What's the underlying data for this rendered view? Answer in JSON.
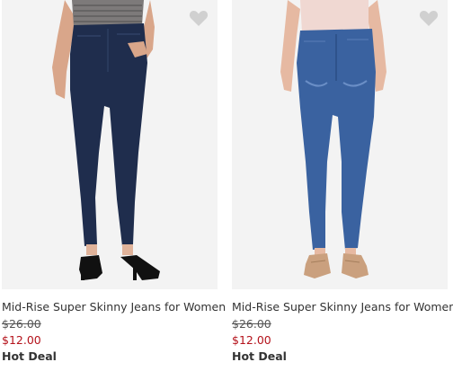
{
  "products": [
    {
      "title": "Mid-Rise Super Skinny Jeans for Women",
      "original_price": "$26.00",
      "sale_price": "$12.00",
      "badge": "Hot Deal",
      "wash_color": "#1f2d4d",
      "shoe": "black-heels",
      "favorite_icon": "heart-icon"
    },
    {
      "title": "Mid-Rise Super Skinny Jeans for Women",
      "original_price": "$26.00",
      "sale_price": "$12.00",
      "badge": "Hot Deal",
      "wash_color": "#3a62a0",
      "shoe": "tan-oxfords",
      "favorite_icon": "heart-icon"
    }
  ],
  "colors": {
    "sale": "#b4121b",
    "text": "#333333",
    "photo_bg": "#f2f2f2",
    "heart": "#d0d0d0"
  }
}
